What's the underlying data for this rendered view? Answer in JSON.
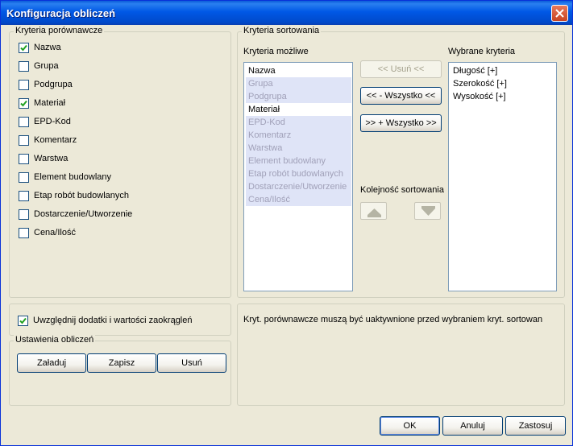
{
  "window": {
    "title": "Konfiguracja obliczeń"
  },
  "compare": {
    "legend": "Kryteria porównawcze",
    "items": [
      {
        "label": "Nazwa",
        "checked": true
      },
      {
        "label": "Grupa",
        "checked": false
      },
      {
        "label": "Podgrupa",
        "checked": false
      },
      {
        "label": "Materiał",
        "checked": true
      },
      {
        "label": "EPD-Kod",
        "checked": false
      },
      {
        "label": "Komentarz",
        "checked": false
      },
      {
        "label": "Warstwa",
        "checked": false
      },
      {
        "label": "Element budowlany",
        "checked": false
      },
      {
        "label": "Etap robót budowlanych",
        "checked": false
      },
      {
        "label": "Dostarczenie/Utworzenie",
        "checked": false
      },
      {
        "label": "Cena/Ilość",
        "checked": false
      }
    ]
  },
  "sorting": {
    "legend": "Kryteria sortowania",
    "possible_label": "Kryteria możliwe",
    "possible": [
      {
        "label": "Nazwa",
        "enabled": true
      },
      {
        "label": "Grupa",
        "enabled": false
      },
      {
        "label": "Podgrupa",
        "enabled": false
      },
      {
        "label": "Materiał",
        "enabled": true
      },
      {
        "label": "EPD-Kod",
        "enabled": false
      },
      {
        "label": "Komentarz",
        "enabled": false
      },
      {
        "label": "Warstwa",
        "enabled": false
      },
      {
        "label": "Element budowlany",
        "enabled": false
      },
      {
        "label": "Etap robót budowlanych",
        "enabled": false
      },
      {
        "label": "Dostarczenie/Utworzenie",
        "enabled": false
      },
      {
        "label": "Cena/Ilość",
        "enabled": false
      }
    ],
    "remove_label": "<< Usuń <<",
    "remove_all_label": "<< - Wszystko <<",
    "add_all_label": ">> + Wszystko >>",
    "order_label": "Kolejność sortowania",
    "selected_label": "Wybrane kryteria",
    "selected": [
      "Długość [+]",
      "Szerokość [+]",
      "Wysokość [+]"
    ]
  },
  "include_label": "Uwzględnij dodatki i wartości zaokrągleń",
  "include_checked": true,
  "settings": {
    "legend": "Ustawienia obliczeń",
    "load_label": "Załaduj",
    "save_label": "Zapisz",
    "delete_label": "Usuń"
  },
  "info_text": "Kryt. porównawcze muszą być uaktywnione przed wybraniem kryt. sortowan",
  "footer": {
    "ok_label": "OK",
    "cancel_label": "Anuluj",
    "apply_label": "Zastosuj"
  },
  "colors": {
    "title_bar": "#0058e6",
    "window_bg": "#ece9d8",
    "disabled_item_bg": "#dfe4f7"
  }
}
